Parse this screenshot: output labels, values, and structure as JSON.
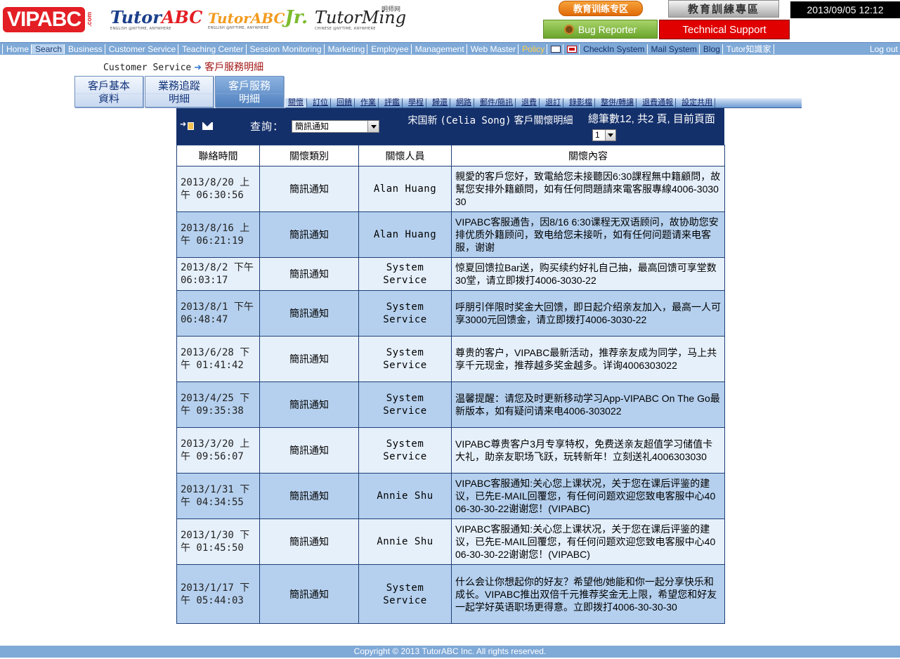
{
  "header": {
    "logos": {
      "vipabc": "VIPABC",
      "vipabc_com": ".com",
      "tutorabc_main": "Tutor",
      "tutorabc_accent": "ABC",
      "tutorabc_tag": "ENGLISH @NYTIME, ANYWHERE",
      "jr_main": "TutorABC",
      "jr_accent": "Jr.",
      "jr_tag": "ENGLISH @NYTIME, ANYWHERE",
      "ming_main": "TutorMing",
      "ming_sub": "明师网",
      "ming_tag": "CHINESE @NYTIME, ANYWHERE"
    },
    "training_button": "教育训练专区",
    "training_zone_button": "教育訓練專區",
    "datetime": "2013/09/05 12:12",
    "bug_reporter": "Bug Reporter",
    "technical_support": "Technical Support"
  },
  "nav": {
    "items": [
      "Home",
      "Search",
      "Business",
      "Customer Service",
      "Teaching Center",
      "Session Monitoring",
      "Marketing",
      "Employee",
      "Management",
      "Web Master",
      "Policy"
    ],
    "items_right": [
      "CheckIn System",
      "Mail System",
      "Blog",
      "Tutor知識家"
    ],
    "logout": "Log out"
  },
  "breadcrumb": {
    "section": "Customer Service",
    "current": "客戶服務明細"
  },
  "main_tabs": [
    {
      "line1": "客戶基本",
      "line2": "資料"
    },
    {
      "line1": "業務追蹤",
      "line2": "明細"
    },
    {
      "line1": "客戶服務",
      "line2": "明細"
    }
  ],
  "sub_tabs": [
    "關懷",
    "訂位",
    "回饋",
    "作業",
    "評鑑",
    "學程",
    "歸還",
    "網路",
    "郵件/簡訊",
    "退費",
    "退訂",
    "錄影檔",
    "整併/轉讓",
    "退費通報",
    "設定共用"
  ],
  "query": {
    "label": "查詢：",
    "selected": "簡訊通知",
    "title_name": "宋国新",
    "title_en": "(Celia Song)",
    "title_suffix": "客戶關懷明細",
    "info": "總筆數12, 共2 頁, 目前頁面",
    "page": "1"
  },
  "table": {
    "columns": [
      "聯絡時間",
      "關懷類別",
      "關懷人員",
      "關懷內容"
    ],
    "rows": [
      {
        "time": "2013/8/20 上午 06:30:56",
        "type": "簡訊通知",
        "person": "Alan Huang",
        "content": "親愛的客戶您好，致電給您未接聽因6:30課程無中籍顧問，故幫您安排外籍顧問，如有任何問題請來電客服專線4006-303030"
      },
      {
        "time": "2013/8/16 上午 06:21:19",
        "type": "簡訊通知",
        "person": "Alan Huang",
        "content": "VIPABC客服通告，因8/16 6:30课程无双语顾问，故协助您安排优质外籍顾问，致电给您未接听，如有任何问题请来电客服，谢谢"
      },
      {
        "time": "2013/8/2 下午 06:03:17",
        "type": "簡訊通知",
        "person": "System Service",
        "content": "惊夏回馈拉Bar送，购买续约好礼自己抽，最高回馈可享堂数30堂，请立即拨打4006-3030-22"
      },
      {
        "time": "2013/8/1 下午 06:48:47",
        "type": "簡訊通知",
        "person": "System Service",
        "content": "呼朋引伴限时奖金大回馈，即日起介绍亲友加入，最高一人可享3000元回馈金，请立即拨打4006-3030-22"
      },
      {
        "time": "2013/6/28 下午 01:41:42",
        "type": "簡訊通知",
        "person": "System Service",
        "content": "尊贵的客户，VIPABC最新活动，推荐亲友成为同学，马上共享千元现金，推荐越多奖金越多。详询4006303022"
      },
      {
        "time": "2013/4/25 下午 09:35:38",
        "type": "簡訊通知",
        "person": "System Service",
        "content": "温馨提醒：请您及时更新移动学习App-VIPABC On The Go最新版本，如有疑问请来电4006-303022"
      },
      {
        "time": "2013/3/20 上午 09:56:07",
        "type": "簡訊通知",
        "person": "System Service",
        "content": "VIPABC尊贵客户3月专享特权，免费送亲友超值学习储值卡大礼，助亲友职场飞跃，玩转新年！立刻送礼4006303030"
      },
      {
        "time": "2013/1/31 下午 04:34:55",
        "type": "簡訊通知",
        "person": "Annie Shu",
        "content": "VIPABC客服通知:关心您上课状况，关于您在课后评鉴的建议，已先E-MAIL回覆您，有任何问题欢迎您致电客服中心4006-30-30-22谢谢您！(VIPABC)"
      },
      {
        "time": "2013/1/30 下午 01:45:50",
        "type": "簡訊通知",
        "person": "Annie Shu",
        "content": "VIPABC客服通知:关心您上课状况，关于您在课后评鉴的建议，已先E-MAIL回覆您，有任何问题欢迎您致电客服中心4006-30-30-22谢谢您！(VIPABC)"
      },
      {
        "time": "2013/1/17 下午 05:44:03",
        "type": "簡訊通知",
        "person": "System Service",
        "content": "什么会让你想起你的好友？希望他/她能和你一起分享快乐和成长。VIPABC推出双倍千元推荐奖金无上限，希望您和好友一起学好英语职场更得意。立即拨打4006-30-30-30"
      }
    ]
  },
  "footer": "Copyright © 2013 TutorABC Inc. All rights reserved.",
  "colors": {
    "nav_bar": "#7fa9d7",
    "panel": "#14306b",
    "row_light": "#e6f0fb",
    "row_dark": "#b5d0ee",
    "support_red": "#e00000",
    "breadcrumb_current": "#a31515"
  }
}
